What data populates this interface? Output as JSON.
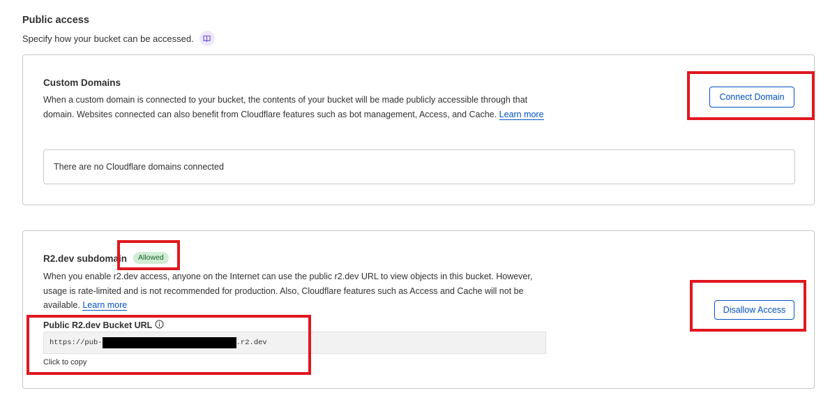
{
  "public_access": {
    "title": "Public access",
    "subtitle": "Specify how your bucket can be accessed."
  },
  "custom_domains": {
    "title": "Custom Domains",
    "description": "When a custom domain is connected to your bucket, the contents of your bucket will be made publicly accessible through that domain. Websites connected can also benefit from Cloudflare features such as bot management, Access, and Cache.",
    "learn_more": "Learn more",
    "connect_button": "Connect Domain",
    "empty_message": "There are no Cloudflare domains connected"
  },
  "r2_subdomain": {
    "title": "R2.dev subdomain",
    "status_badge": "Allowed",
    "description": "When you enable r2.dev access, anyone on the Internet can use the public r2.dev URL to view objects in this bucket. However, usage is rate-limited and is not recommended for production. Also, Cloudflare features such as Access and Cache will not be available.",
    "learn_more": "Learn more",
    "url_label": "Public R2.dev Bucket URL",
    "url_prefix": "https://pub-",
    "url_suffix": ".r2.dev",
    "copy_hint": "Click to copy",
    "disallow_button": "Disallow Access"
  },
  "colors": {
    "accent": "#0051c3",
    "highlight": "#e0171f",
    "badge_bg": "#cfeed4",
    "badge_text": "#1d5e2c"
  }
}
